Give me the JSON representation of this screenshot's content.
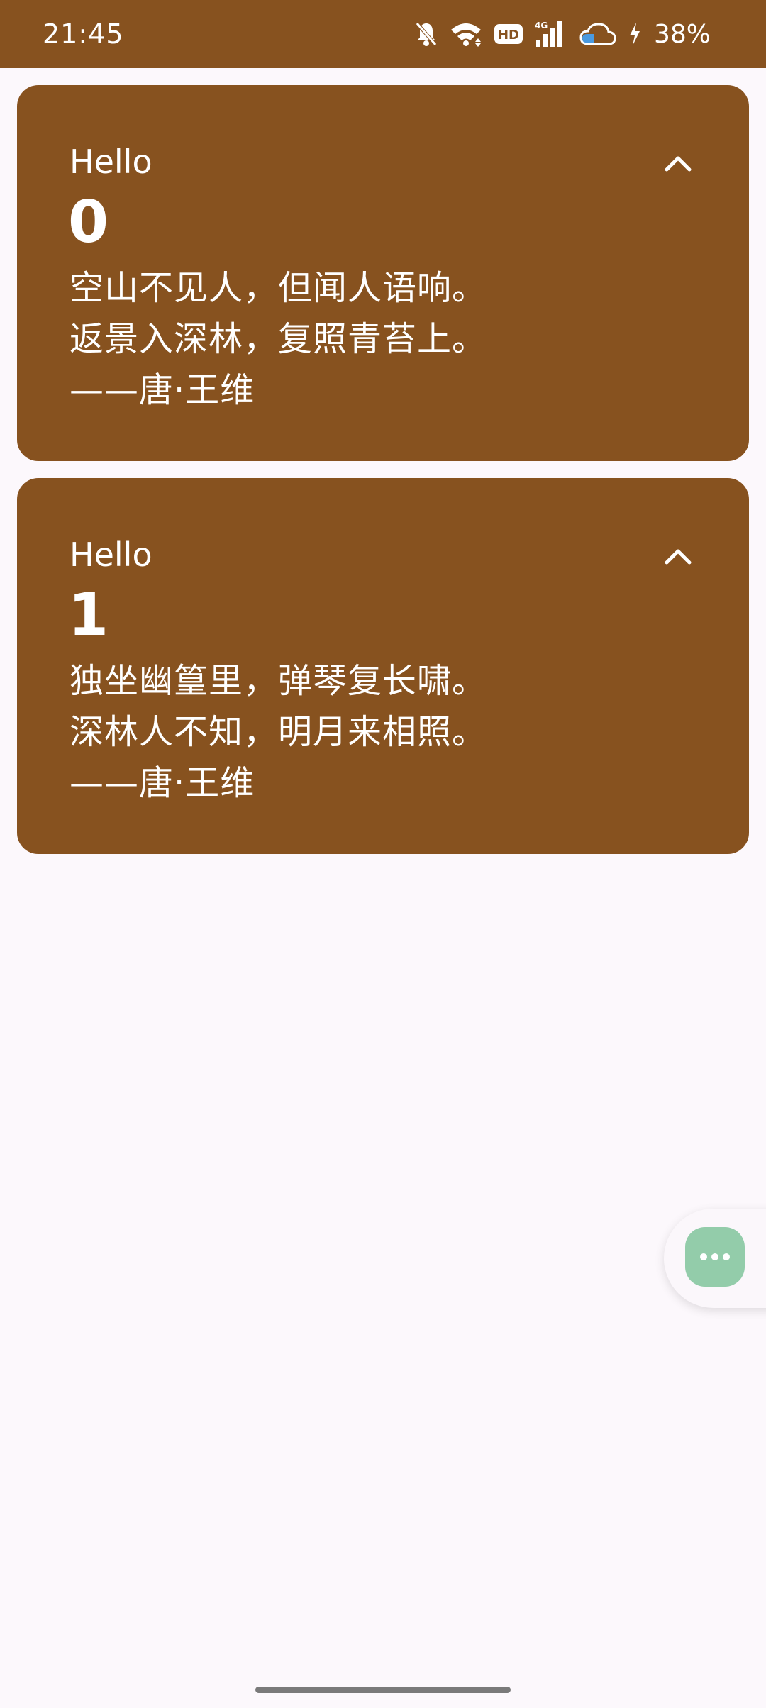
{
  "status_bar": {
    "time": "21:45",
    "battery": "38%",
    "icons": [
      "bell-off-icon",
      "wifi-icon",
      "hd-icon",
      "signal-4g-icon",
      "cloud-icon",
      "charging-icon"
    ]
  },
  "cards": [
    {
      "title": "Hello",
      "number": "0",
      "lines": [
        "空山不见人，但闻人语响。",
        "返景入深林，复照青苔上。",
        "——唐·王维"
      ],
      "toggle_icon": "chevron-up-icon"
    },
    {
      "title": "Hello",
      "number": "1",
      "lines": [
        "独坐幽篁里，弹琴复长啸。",
        "深林人不知，明月来相照。",
        "——唐·王维"
      ],
      "toggle_icon": "chevron-up-icon"
    }
  ],
  "fab": {
    "icon": "more-horizontal-icon"
  },
  "colors": {
    "card_bg": "#87521f",
    "status_bar_bg": "#87521f",
    "page_bg": "#fcf8fc",
    "fab_bg": "#93ccaa",
    "text": "#ffffff"
  }
}
